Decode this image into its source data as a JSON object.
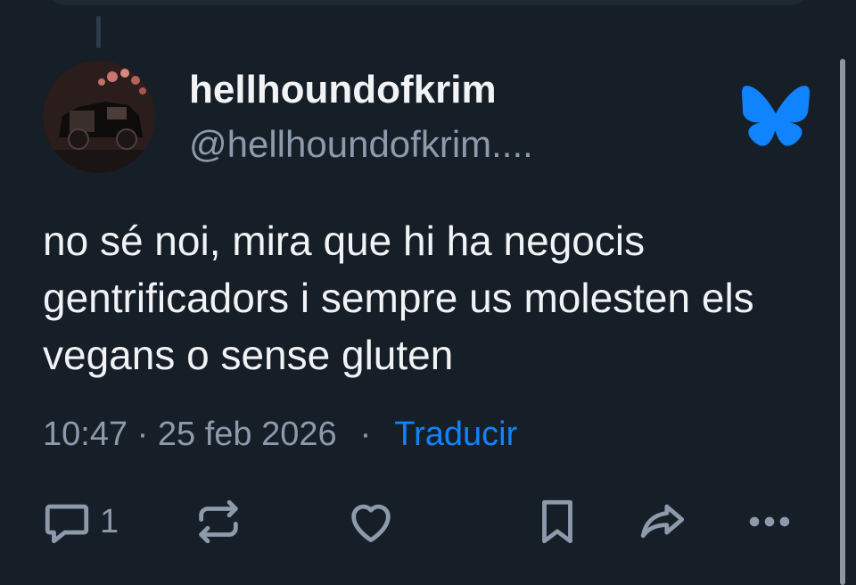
{
  "post": {
    "author": {
      "display_name": "hellhoundofkrim",
      "handle": "@hellhoundofkrim...."
    },
    "text": "no sé noi, mira que hi ha negocis gentrificadors i sempre us molesten els vegans o sense gluten",
    "timestamp": "10:47 · 25 feb 2026",
    "separator": "·",
    "translate_label": "Traducir"
  },
  "actions": {
    "reply_count": "1"
  },
  "icons": {
    "service_logo": "bluesky-butterfly-icon",
    "reply": "reply-icon",
    "repost": "repost-icon",
    "like": "heart-icon",
    "bookmark": "bookmark-icon",
    "share": "share-icon",
    "more": "more-icon"
  },
  "colors": {
    "background": "#161e27",
    "text": "#f1f3f5",
    "muted": "#8c9aab",
    "accent": "#1083fe"
  }
}
